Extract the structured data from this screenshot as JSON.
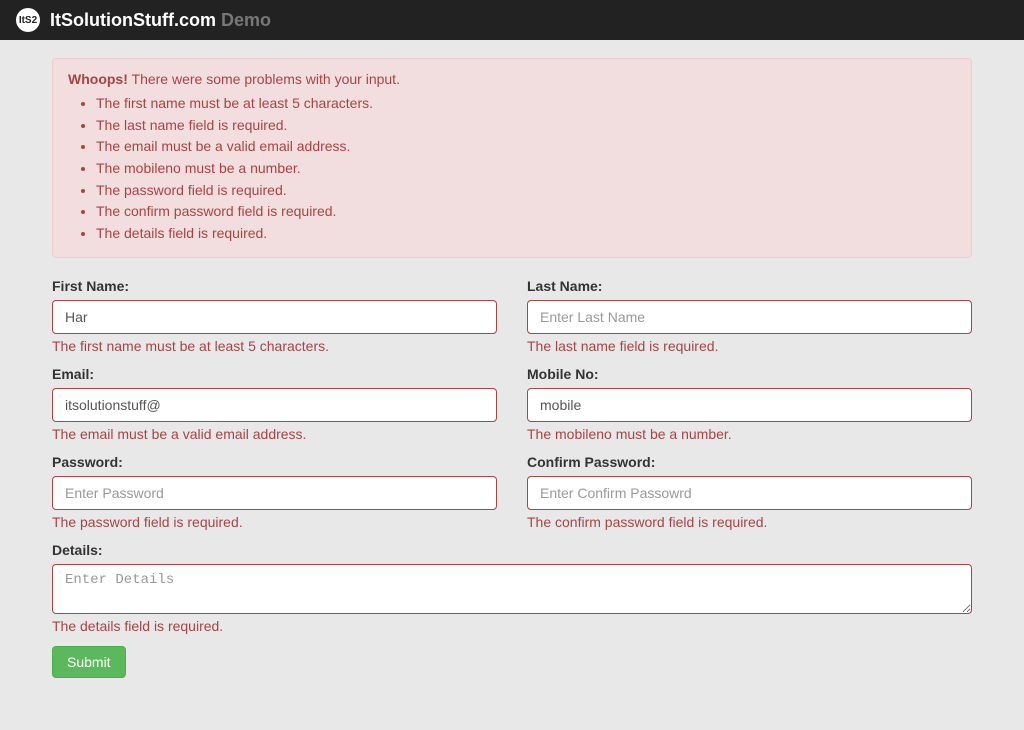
{
  "navbar": {
    "logo_text": "ItS2",
    "brand": "ItSolutionStuff.com",
    "demo_label": "Demo"
  },
  "alert": {
    "heading": "Whoops!",
    "subtext": "There were some problems with your input.",
    "items": [
      "The first name must be at least 5 characters.",
      "The last name field is required.",
      "The email must be a valid email address.",
      "The mobileno must be a number.",
      "The password field is required.",
      "The confirm password field is required.",
      "The details field is required."
    ]
  },
  "form": {
    "first_name": {
      "label": "First Name:",
      "value": "Har",
      "placeholder": "",
      "error": "The first name must be at least 5 characters."
    },
    "last_name": {
      "label": "Last Name:",
      "value": "",
      "placeholder": "Enter Last Name",
      "error": "The last name field is required."
    },
    "email": {
      "label": "Email:",
      "value": "itsolutionstuff@",
      "placeholder": "",
      "error": "The email must be a valid email address."
    },
    "mobile": {
      "label": "Mobile No:",
      "value": "mobile",
      "placeholder": "",
      "error": "The mobileno must be a number."
    },
    "password": {
      "label": "Password:",
      "value": "",
      "placeholder": "Enter Password",
      "error": "The password field is required."
    },
    "confirm_password": {
      "label": "Confirm Password:",
      "value": "",
      "placeholder": "Enter Confirm Passowrd",
      "error": "The confirm password field is required."
    },
    "details": {
      "label": "Details:",
      "value": "",
      "placeholder": "Enter Details",
      "error": "The details field is required."
    },
    "submit_label": "Submit"
  }
}
